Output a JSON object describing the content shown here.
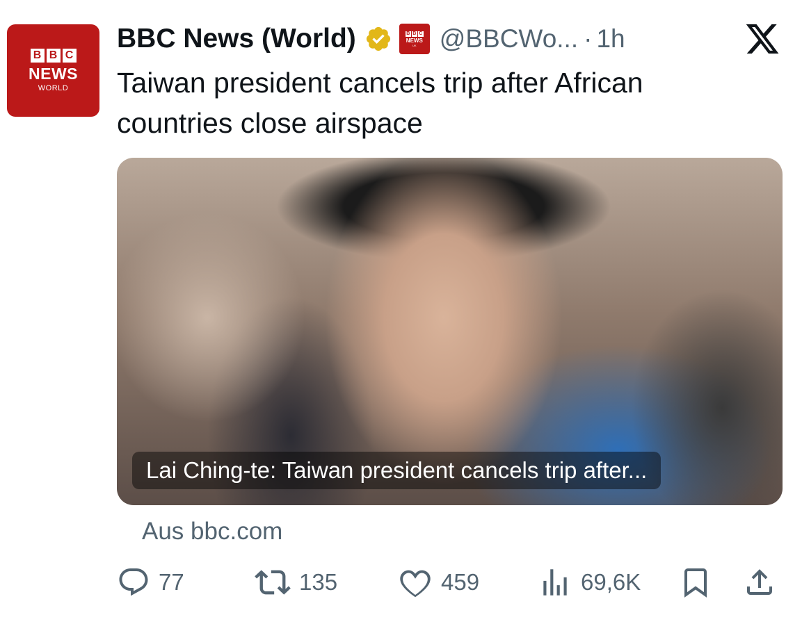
{
  "author": {
    "avatar_lines": [
      "B",
      "B",
      "C",
      "NEWS",
      "WORLD"
    ],
    "display_name": "BBC News (World)",
    "handle": "@BBCWo...",
    "separator": "·",
    "time": "1h",
    "mini_logo_lines": [
      "B",
      "B",
      "C",
      "NEWS",
      "UK"
    ]
  },
  "tweet": {
    "text": "Taiwan president cancels trip after African countries close airspace"
  },
  "card": {
    "caption": "Lai Ching-te: Taiwan president cancels trip after...",
    "source": "Aus bbc.com"
  },
  "actions": {
    "replies": "77",
    "reposts": "135",
    "likes": "459",
    "views": "69,6K"
  },
  "colors": {
    "bbc_red": "#bb1919",
    "verified_gold": "#e2b719",
    "muted_text": "#536471",
    "text": "#0f1419"
  },
  "icons": [
    "verified-icon",
    "x-logo-icon",
    "reply-icon",
    "repost-icon",
    "like-icon",
    "views-icon",
    "bookmark-icon",
    "share-icon"
  ]
}
